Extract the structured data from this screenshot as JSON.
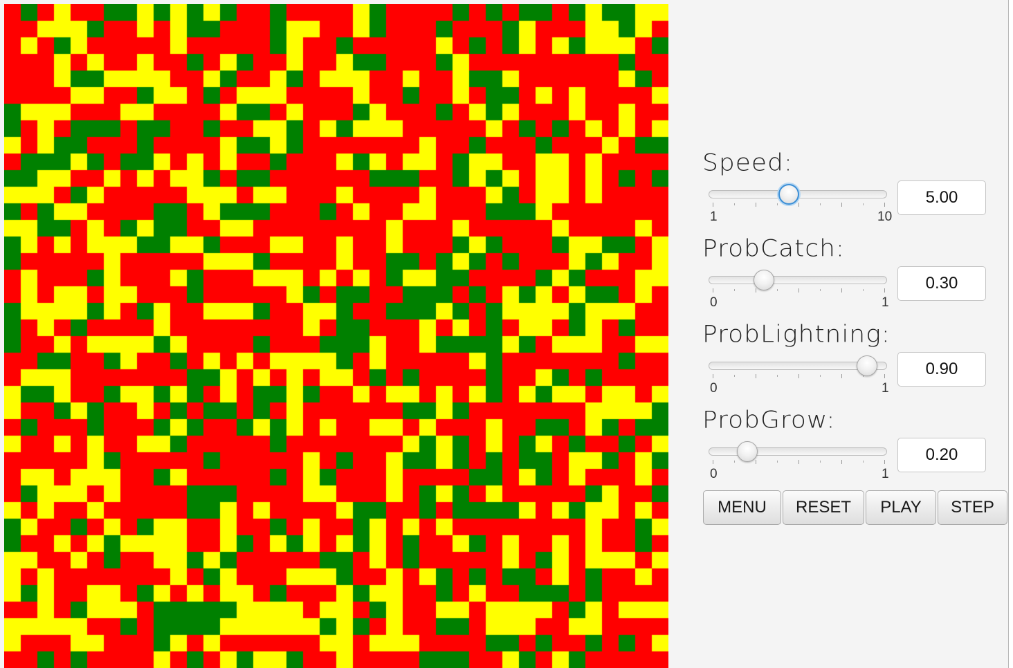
{
  "simulation": {
    "grid_size": 40,
    "colors": {
      "tree": "#008000",
      "fire": "#ff0000",
      "empty": "#ffff00"
    }
  },
  "controls": {
    "speed": {
      "label": "Speed:",
      "value": 5.0,
      "value_text": "5.00",
      "min": 1,
      "max": 10,
      "min_label": "1",
      "max_label": "10"
    },
    "prob_catch": {
      "label": "ProbCatch:",
      "value": 0.3,
      "value_text": "0.30",
      "min": 0,
      "max": 1,
      "min_label": "0",
      "max_label": "1"
    },
    "prob_lightning": {
      "label": "ProbLightning:",
      "value": 0.9,
      "value_text": "0.90",
      "min": 0,
      "max": 1,
      "min_label": "0",
      "max_label": "1"
    },
    "prob_grow": {
      "label": "ProbGrow:",
      "value": 0.2,
      "value_text": "0.20",
      "min": 0,
      "max": 1,
      "min_label": "0",
      "max_label": "1"
    }
  },
  "buttons": {
    "menu": "MENU",
    "reset": "RESET",
    "play": "PLAY",
    "step": "STEP"
  }
}
